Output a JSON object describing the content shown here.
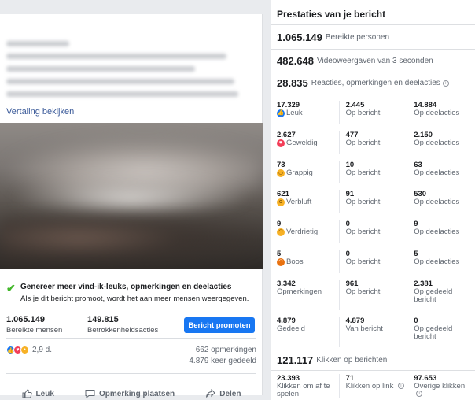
{
  "post": {
    "translate_link": "Vertaling bekijken",
    "promo_title": "Genereer meer vind-ik-leuks, opmerkingen en deelacties",
    "promo_sub": "Als je dit bericht promoot, wordt het aan meer mensen weergegeven.",
    "reach_value": "1.065.149",
    "reach_label": "Bereikte mensen",
    "engagement_value": "149.815",
    "engagement_label": "Betrokkenheidsacties",
    "promote_button": "Bericht promoten",
    "reaction_count": "2,9 d.",
    "comments": "662 opmerkingen",
    "shares": "4.879 keer gedeeld",
    "actions": {
      "like": "Leuk",
      "comment": "Opmerking plaatsen",
      "share": "Delen"
    }
  },
  "panel": {
    "title": "Prestaties van je bericht",
    "reach_value": "1.065.149",
    "reach_label": "Bereikte personen",
    "views_value": "482.648",
    "views_label": "Videoweergaven van 3 seconden",
    "engagement_value": "28.835",
    "engagement_label": "Reacties, opmerkingen en deelacties",
    "rows": [
      {
        "total": "17.329",
        "label": "Leuk",
        "icon": "like-icon",
        "post": "2.445",
        "post_label": "Op bericht",
        "shares": "14.884",
        "shares_label": "Op deelacties"
      },
      {
        "total": "2.627",
        "label": "Geweldig",
        "icon": "love-icon",
        "post": "477",
        "post_label": "Op bericht",
        "shares": "2.150",
        "shares_label": "Op deelacties"
      },
      {
        "total": "73",
        "label": "Grappig",
        "icon": "haha-icon",
        "post": "10",
        "post_label": "Op bericht",
        "shares": "63",
        "shares_label": "Op deelacties"
      },
      {
        "total": "621",
        "label": "Verbluft",
        "icon": "wow-icon",
        "post": "91",
        "post_label": "Op bericht",
        "shares": "530",
        "shares_label": "Op deelacties"
      },
      {
        "total": "9",
        "label": "Verdrietig",
        "icon": "sad-icon",
        "post": "0",
        "post_label": "Op bericht",
        "shares": "9",
        "shares_label": "Op deelacties"
      },
      {
        "total": "5",
        "label": "Boos",
        "icon": "angry-icon",
        "post": "0",
        "post_label": "Op bericht",
        "shares": "5",
        "shares_label": "Op deelacties"
      },
      {
        "total": "3.342",
        "label": "Opmerkingen",
        "post": "961",
        "post_label": "Op bericht",
        "shares": "2.381",
        "shares_label": "Op gedeeld bericht"
      },
      {
        "total": "4.879",
        "label": "Gedeeld",
        "post": "4.879",
        "post_label": "Van bericht",
        "shares": "0",
        "shares_label": "Op gedeeld bericht"
      }
    ],
    "clicks_value": "121.117",
    "clicks_label": "Klikken op berichten",
    "clicks": [
      {
        "value": "23.393",
        "label": "Klikken om af te spelen"
      },
      {
        "value": "71",
        "label": "Klikken op link"
      },
      {
        "value": "97.653",
        "label": "Overige klikken"
      }
    ]
  },
  "colors": {
    "accent": "#1877f2",
    "link": "#385898",
    "check": "#42b72a",
    "background": "#e9ebee"
  }
}
